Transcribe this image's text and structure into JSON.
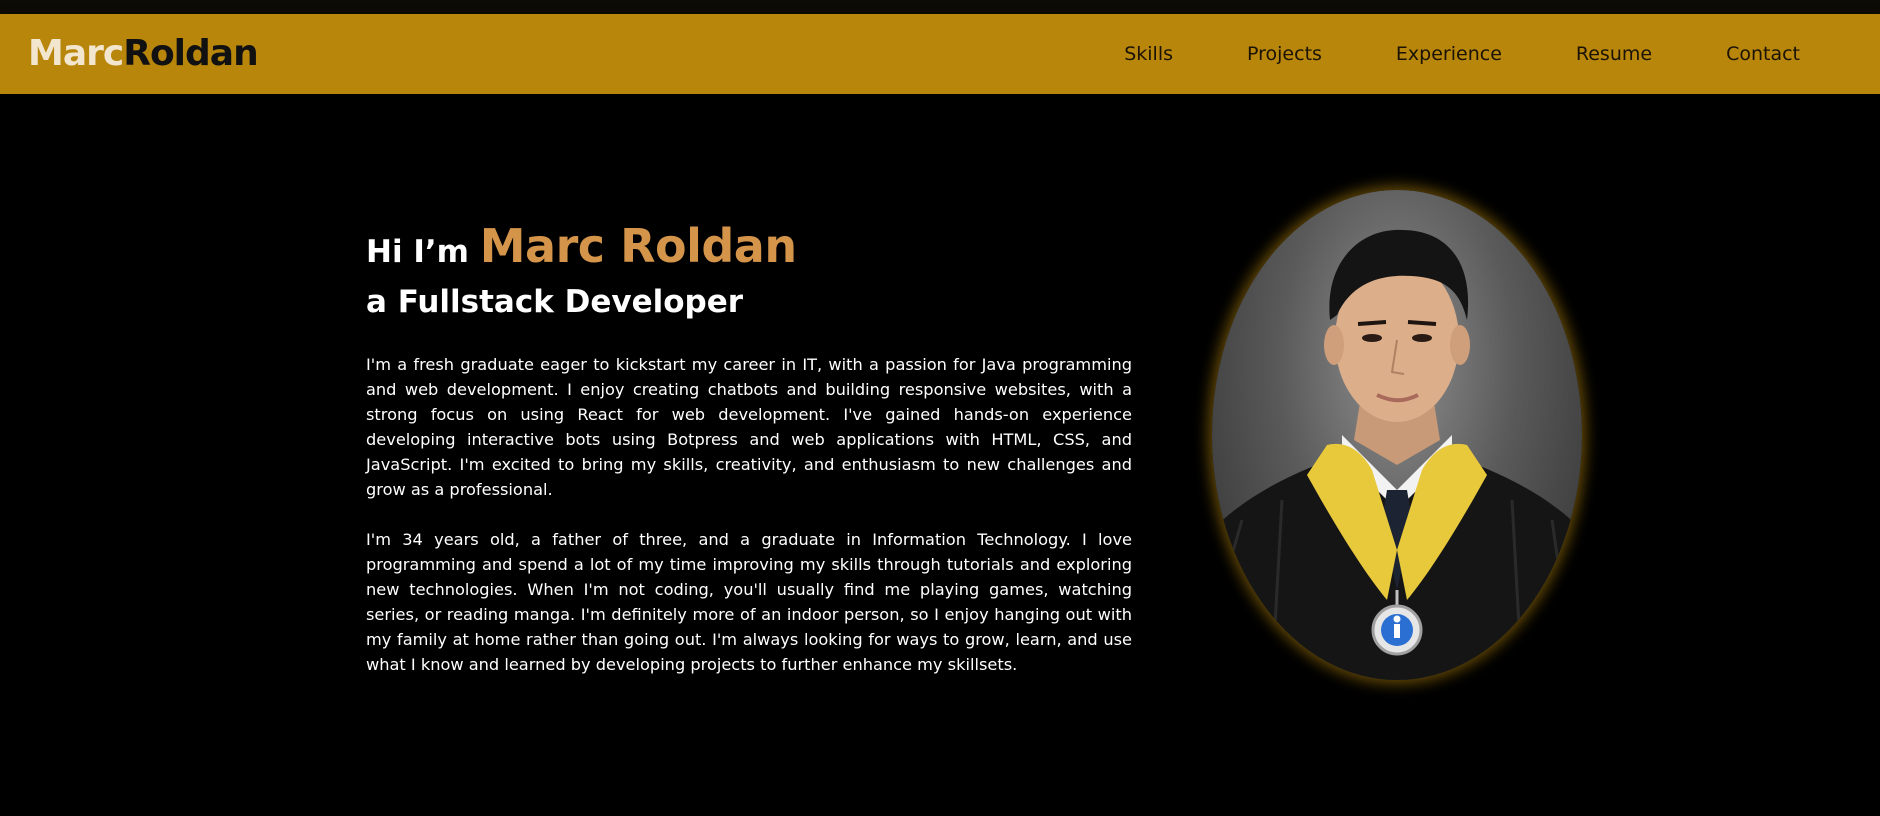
{
  "header": {
    "logo_first": "Marc",
    "logo_last": "Roldan",
    "nav": [
      {
        "label": "Skills"
      },
      {
        "label": "Projects"
      },
      {
        "label": "Experience"
      },
      {
        "label": "Resume"
      },
      {
        "label": "Contact"
      }
    ]
  },
  "hero": {
    "greeting": "Hi I’m",
    "name": "Marc Roldan",
    "role": "a Fullstack Developer",
    "bio_1": "I'm a fresh graduate eager to kickstart my career in IT, with a passion for Java programming and web development. I enjoy creating chatbots and building responsive websites, with a strong focus on using React for web development. I've gained hands-on experience developing interactive bots using Botpress and web applications with HTML, CSS, and JavaScript. I'm excited to bring my skills, creativity, and enthusiasm to new challenges and grow as a professional.",
    "bio_2": "I'm 34 years old, a father of three, and a graduate in Information Technology. I love programming and spend a lot of my time improving my skills through tutorials and exploring new technologies. When I'm not coding, you'll usually find me playing games, watching series, or reading manga. I'm definitely more of an indoor person, so I enjoy hanging out with my family at home rather than going out. I'm always looking for ways to grow, learn, and use what I know and learned by developing projects to further enhance my skillsets.",
    "photo_icon": "graduate-portrait-photo"
  },
  "colors": {
    "navbar_bg": "#b8860b",
    "page_bg": "#000000",
    "accent_name": "#d4954a",
    "logo_first": "#f2e6cf",
    "logo_last": "#111111"
  }
}
